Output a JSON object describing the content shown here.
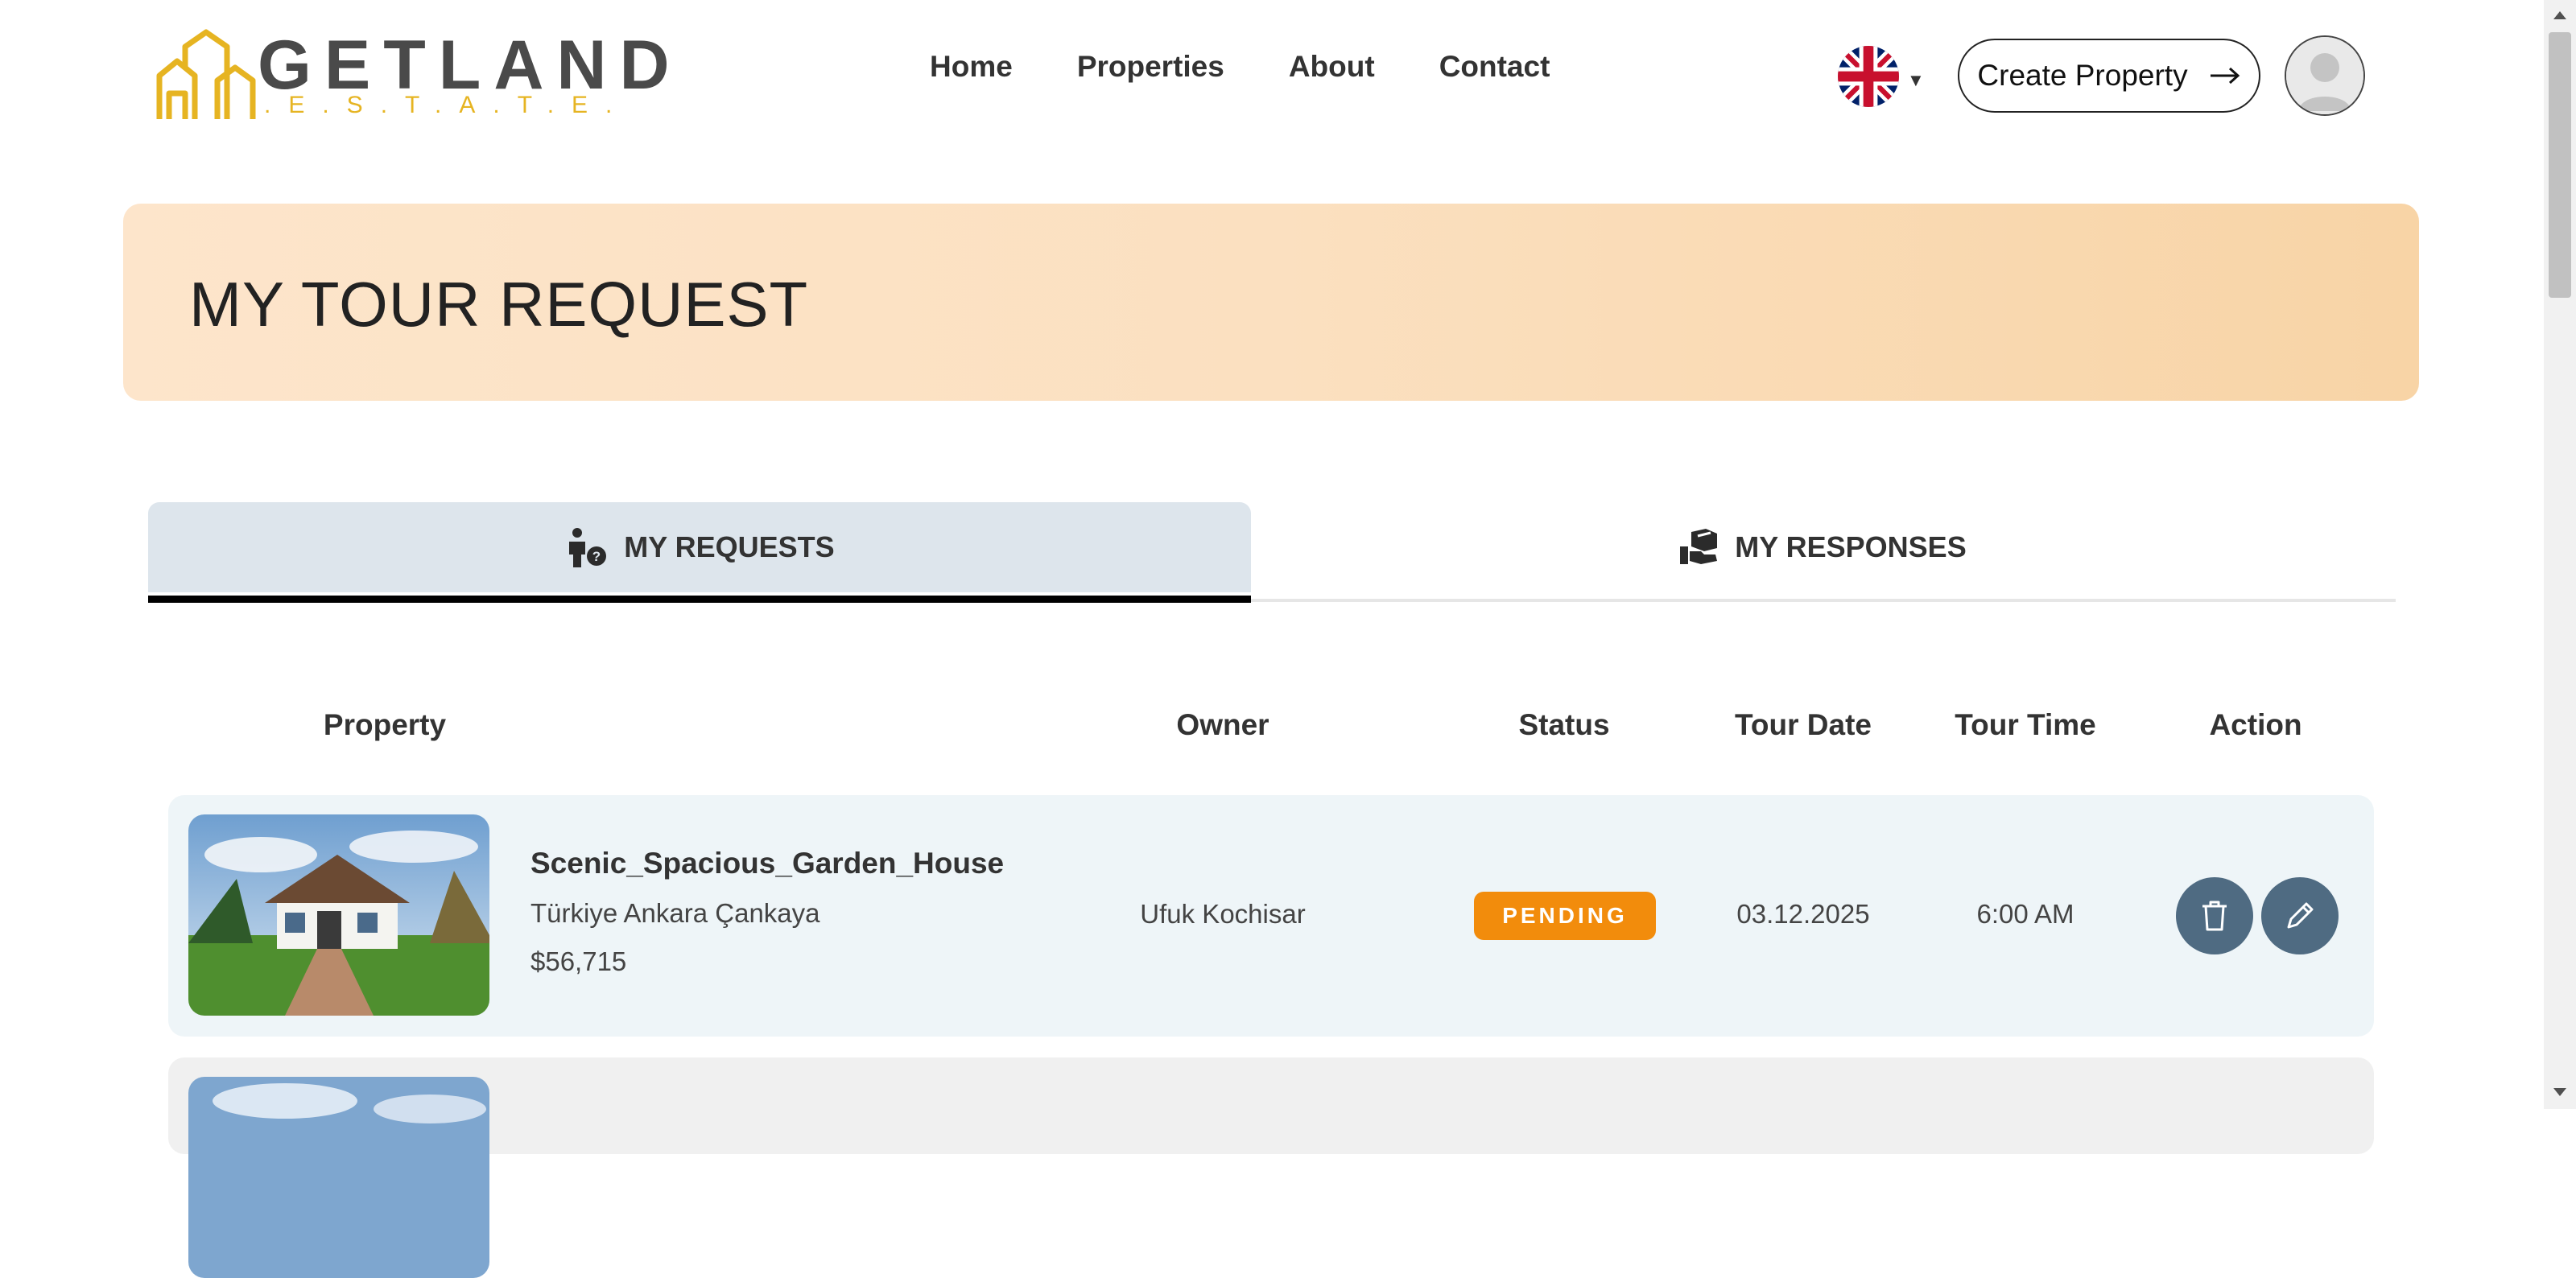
{
  "brand": {
    "name": "GETLAND",
    "tagline": ".E.S.T.A.T.E.",
    "gold": "#e6b422"
  },
  "nav": {
    "items": [
      "Home",
      "Properties",
      "About",
      "Contact"
    ]
  },
  "header": {
    "language_icon": "uk-flag-icon",
    "create_label": "Create Property",
    "create_icon": "arrow-right-icon"
  },
  "banner": {
    "title": "MY TOUR REQUEST"
  },
  "tabs": {
    "active": {
      "label": "MY REQUESTS",
      "icon": "person-question-icon"
    },
    "inactive": {
      "label": "MY RESPONSES",
      "icon": "hand-box-icon"
    }
  },
  "table": {
    "headers": [
      "Property",
      "Owner",
      "Status",
      "Tour Date",
      "Tour Time",
      "Action"
    ],
    "rows": [
      {
        "name": "Scenic_Spacious_Garden_House",
        "location": "Türkiye Ankara Çankaya",
        "price": "$56,715",
        "owner": "Ufuk Kochisar",
        "status": "PENDING",
        "date": "03.12.2025",
        "time": "6:00 AM"
      }
    ]
  },
  "colors": {
    "accent": "#f28c0c",
    "action": "#4f6b82",
    "row_bg": "#eef5f8"
  }
}
